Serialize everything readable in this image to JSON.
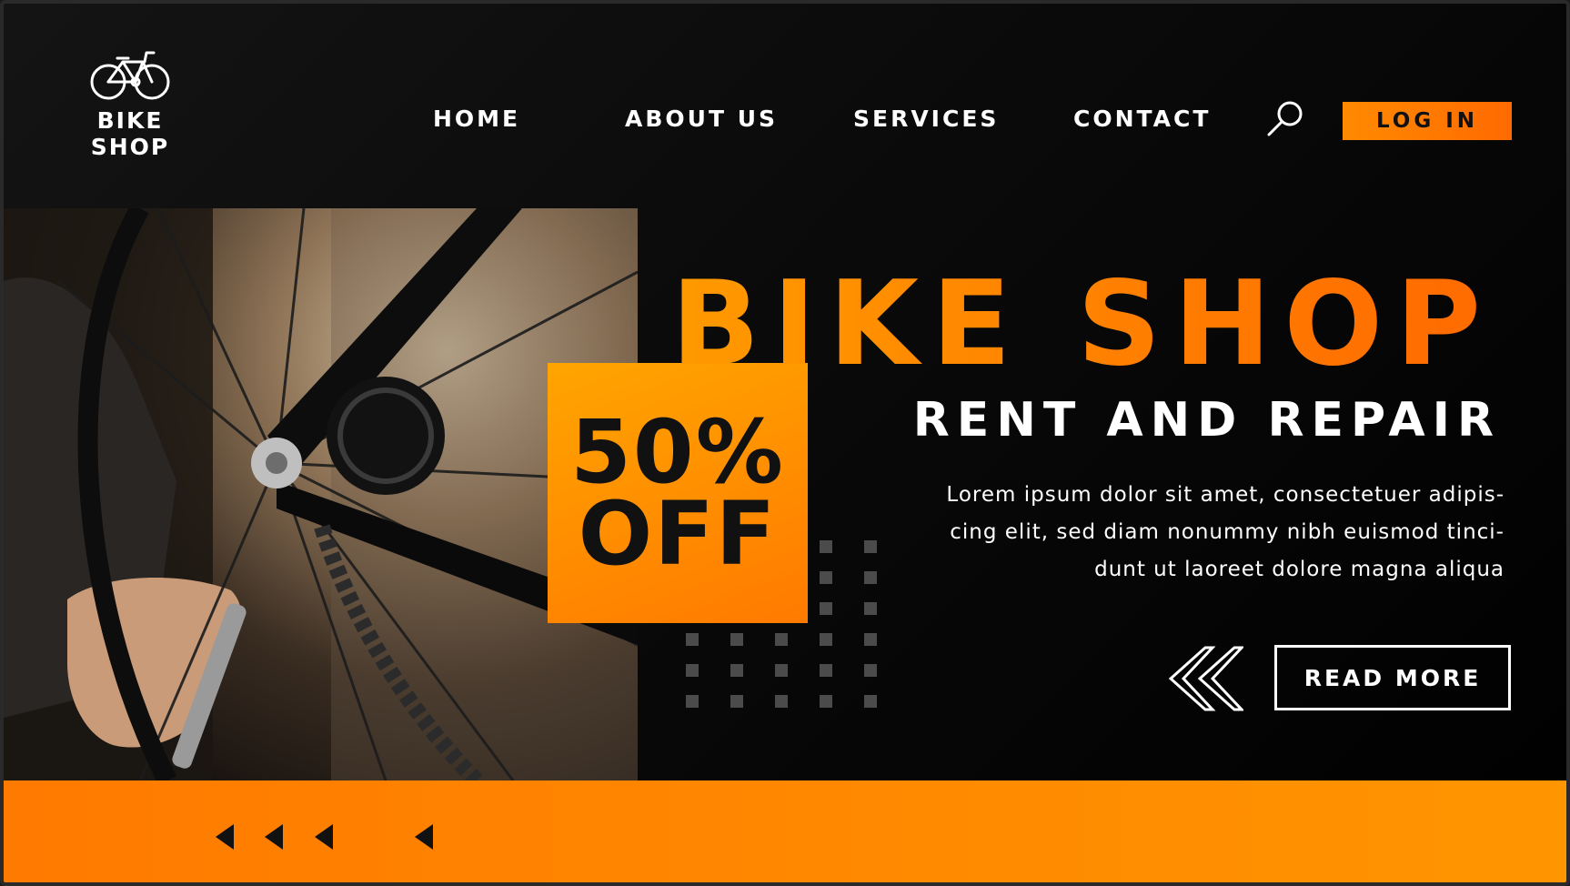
{
  "brand": {
    "logo_text": "BIKE SHOP",
    "logo_icon": "bicycle-icon"
  },
  "nav": {
    "items": [
      {
        "label": "HOME"
      },
      {
        "label": "ABOUT US"
      },
      {
        "label": "SERVICES"
      },
      {
        "label": "CONTACT"
      }
    ],
    "search_icon": "search-icon",
    "login_label": "LOG IN"
  },
  "hero": {
    "title": "BIKE SHOP",
    "subtitle": "RENT AND REPAIR",
    "paragraph": "Lorem ipsum dolor sit amet, consectetuer adipis-cing elit, sed diam nonummy nibh euismod tinci-dunt ut laoreet dolore magna aliqua",
    "read_more_label": "READ MORE",
    "chevron_icon": "double-chevron-left-icon"
  },
  "promo": {
    "line1": "50%",
    "line2": "OFF"
  },
  "photo": {
    "subject": "photo-bike-wheel-repair"
  },
  "footer": {
    "arrow_icon": "triangle-left-icon"
  },
  "colors": {
    "accent": "#ff8000",
    "accent_light": "#ffa500",
    "background": "#000000",
    "text": "#ffffff",
    "dots": "#4b4b4b"
  }
}
